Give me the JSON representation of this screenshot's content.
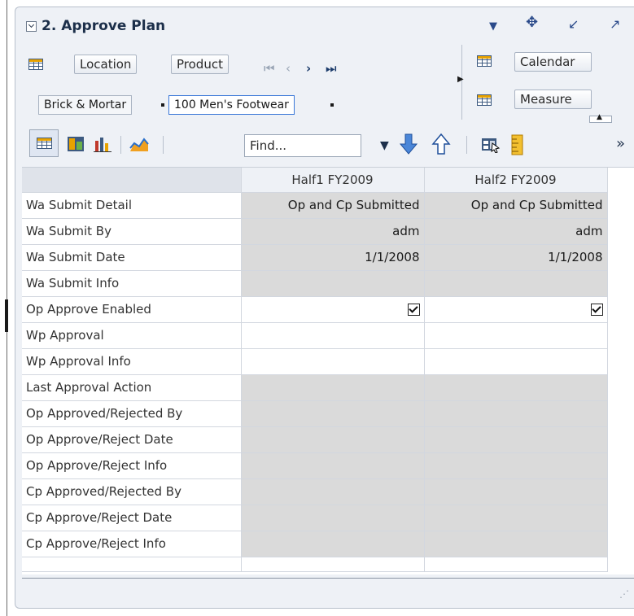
{
  "header": {
    "title": "2. Approve Plan"
  },
  "pivot": {
    "location_label": "Location",
    "product_label": "Product",
    "calendar_label": "Calendar",
    "measure_label": "Measure",
    "location_value": "Brick & Mortar",
    "product_value": "100 Men's Footwear"
  },
  "toolbar": {
    "find_placeholder": "Find..."
  },
  "grid": {
    "columns": [
      "Half1 FY2009",
      "Half2 FY2009"
    ],
    "rows": [
      {
        "label": "Wa Submit Detail",
        "values": [
          "Op and Cp Submitted",
          "Op and Cp Submitted"
        ],
        "editable": false
      },
      {
        "label": "Wa Submit By",
        "values": [
          "adm",
          "adm"
        ],
        "editable": false
      },
      {
        "label": "Wa Submit Date",
        "values": [
          "1/1/2008",
          "1/1/2008"
        ],
        "editable": false
      },
      {
        "label": "Wa Submit Info",
        "values": [
          "",
          ""
        ],
        "editable": false
      },
      {
        "label": "Op Approve Enabled",
        "values": [
          "",
          ""
        ],
        "checked": [
          true,
          true
        ],
        "editable": true
      },
      {
        "label": "Wp Approval",
        "values": [
          "",
          ""
        ],
        "editable": true
      },
      {
        "label": "Wp Approval Info",
        "values": [
          "",
          ""
        ],
        "editable": true
      },
      {
        "label": "Last Approval Action",
        "values": [
          "",
          ""
        ],
        "editable": false
      },
      {
        "label": "Op Approved/Rejected By",
        "values": [
          "",
          ""
        ],
        "editable": false
      },
      {
        "label": "Op Approve/Reject Date",
        "values": [
          "",
          ""
        ],
        "editable": false
      },
      {
        "label": "Op Approve/Reject Info",
        "values": [
          "",
          ""
        ],
        "editable": false
      },
      {
        "label": "Cp Approved/Rejected By",
        "values": [
          "",
          ""
        ],
        "editable": false
      },
      {
        "label": "Cp Approve/Reject Date",
        "values": [
          "",
          ""
        ],
        "editable": false
      },
      {
        "label": "Cp Approve/Reject Info",
        "values": [
          "",
          ""
        ],
        "editable": false
      }
    ]
  },
  "colors": {
    "readonly_cell": "#dadada",
    "accent": "#2a4a8a",
    "selection_border": "#3b78d8"
  }
}
